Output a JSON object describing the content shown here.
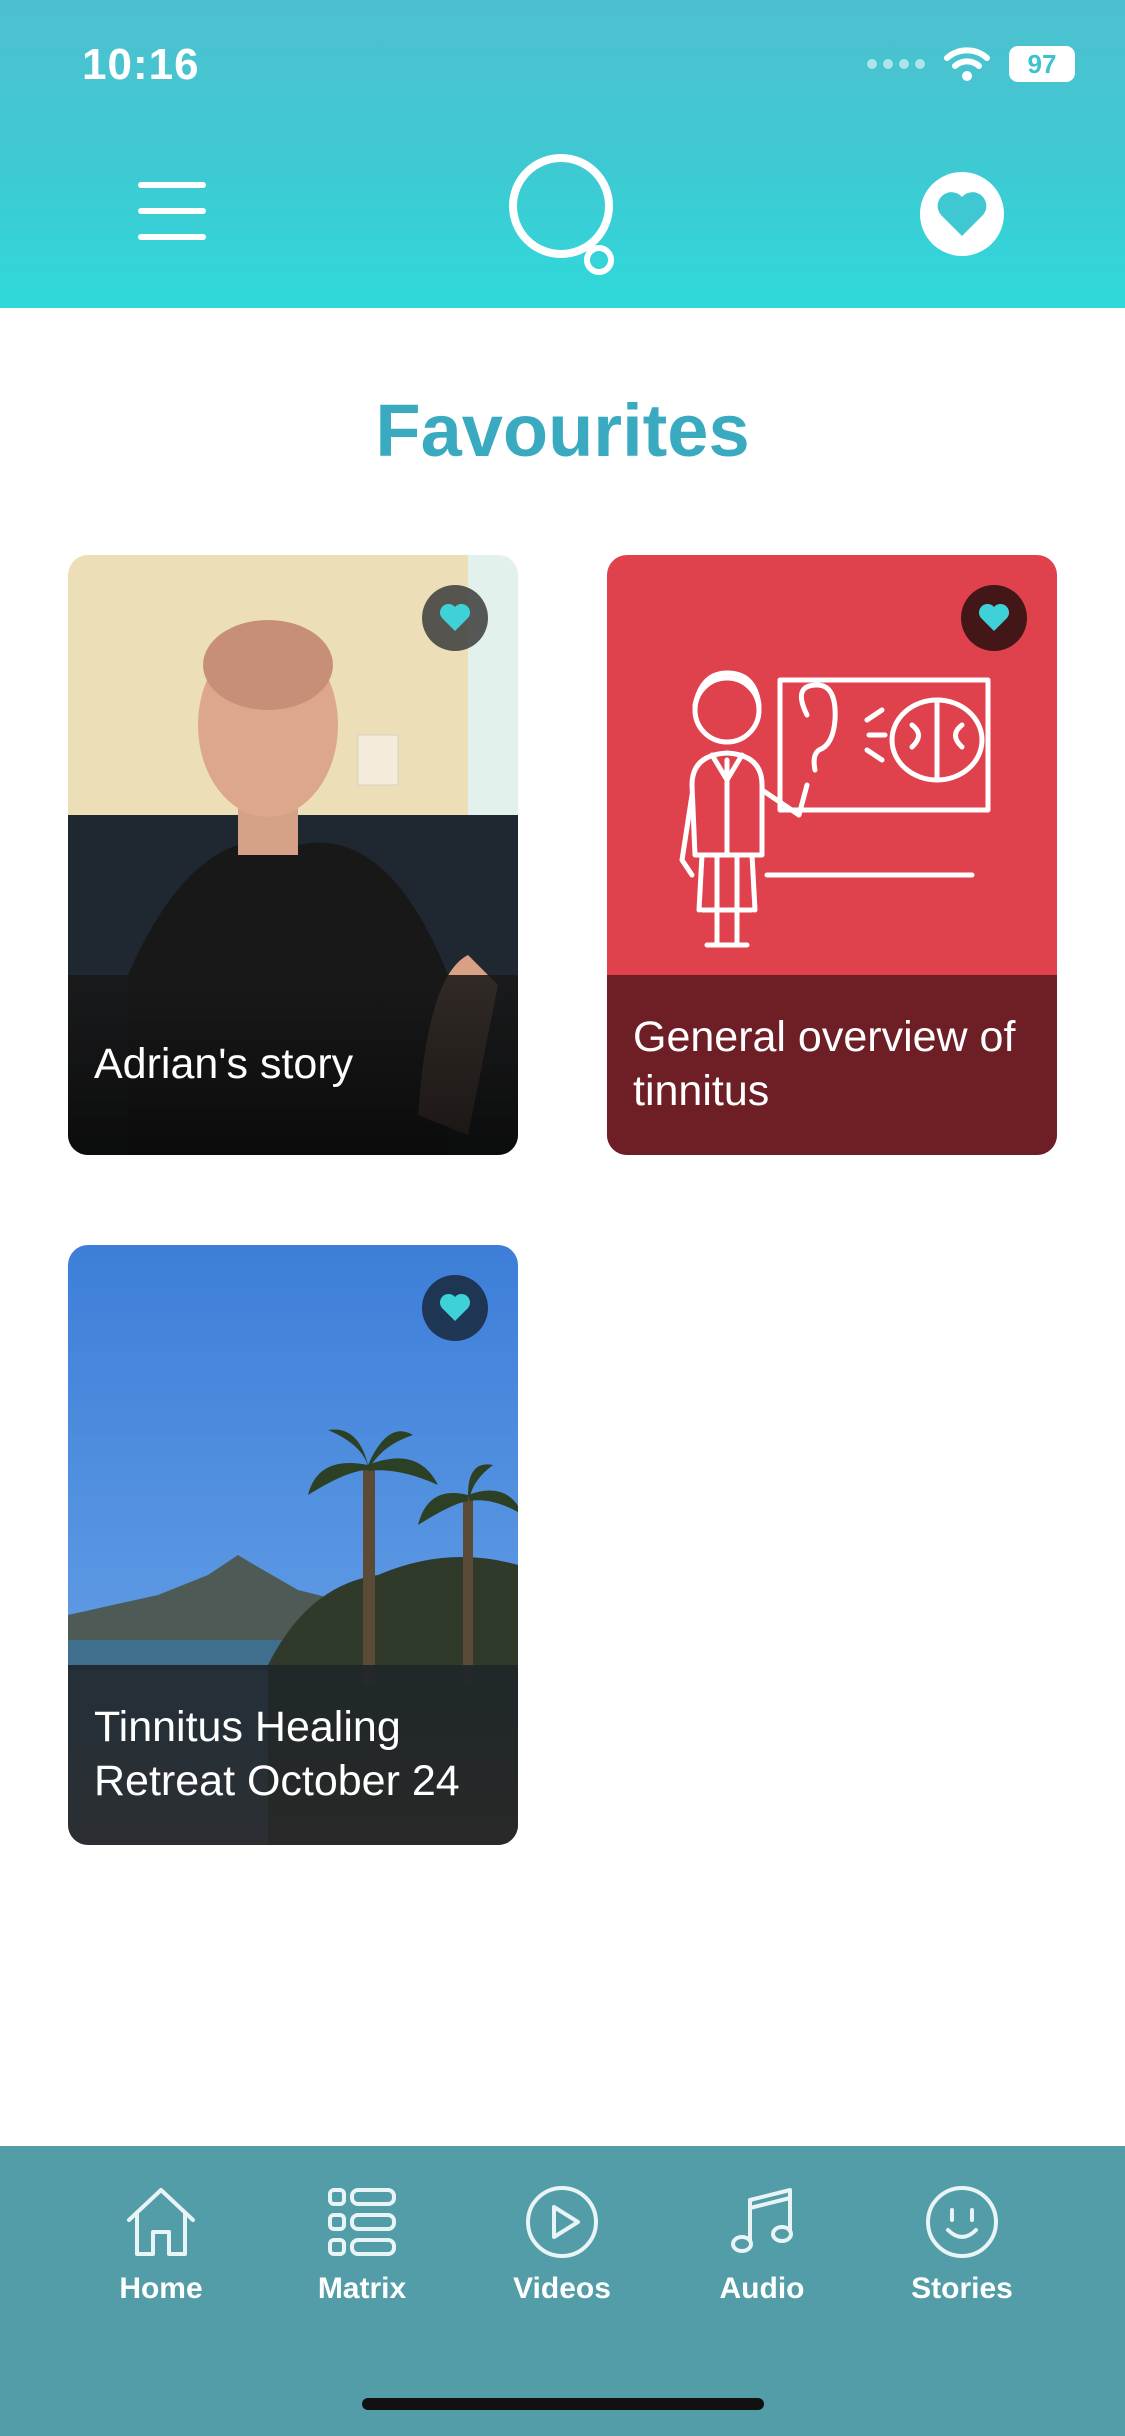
{
  "status": {
    "time": "10:16",
    "battery": "97"
  },
  "header": {
    "menu_icon": "hamburger-menu-icon",
    "logo_icon": "thought-bubble-logo-icon",
    "favourites_icon": "heart-icon"
  },
  "page": {
    "title": "Favourites"
  },
  "cards": [
    {
      "title": "Adrian's story",
      "favourited": true
    },
    {
      "title": "General overview of tinnitus",
      "favourited": true
    },
    {
      "title": "Tinnitus Healing Retreat October 24",
      "favourited": true
    }
  ],
  "nav": {
    "items": [
      {
        "label": "Home",
        "icon": "home-icon"
      },
      {
        "label": "Matrix",
        "icon": "list-icon"
      },
      {
        "label": "Videos",
        "icon": "play-icon"
      },
      {
        "label": "Audio",
        "icon": "music-note-icon"
      },
      {
        "label": "Stories",
        "icon": "smiley-icon"
      }
    ]
  },
  "colors": {
    "accent": "#3fc8d2",
    "title": "#3aaac0",
    "nav_bg": "#539da8",
    "card_red": "#df414d",
    "heart": "#3fd1d8"
  }
}
